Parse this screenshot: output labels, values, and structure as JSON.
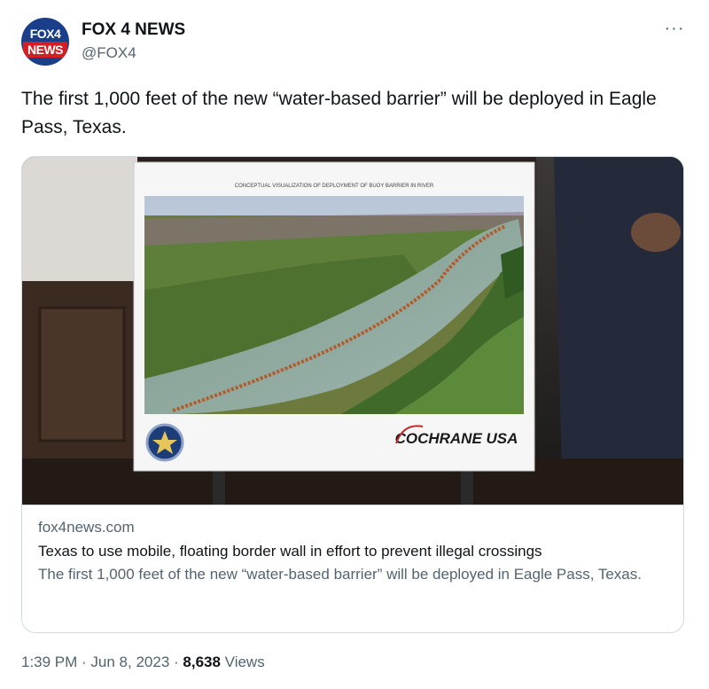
{
  "author": {
    "display_name": "FOX 4 NEWS",
    "handle": "@FOX4",
    "avatar_top": "FOX4",
    "avatar_bottom": "NEWS"
  },
  "more_label": "···",
  "tweet": {
    "text": "The first 1,000 feet of the new “water-based barrier” will be deployed in Eagle Pass, Texas."
  },
  "card": {
    "poster_caption": "CONCEPTUAL VISUALIZATION OF DEPLOYMENT OF BUOY BARRIER IN RIVER",
    "poster_brand": "COCHRANE USA",
    "domain": "fox4news.com",
    "title": "Texas to use mobile, floating border wall in effort to prevent illegal crossings",
    "description": "The first 1,000 feet of the new “water-based barrier” will be deployed in Eagle Pass, Texas."
  },
  "footer": {
    "time": "1:39 PM · Jun 8, 2023",
    "separator": " · ",
    "views_count": "8,638",
    "views_label": " Views"
  },
  "colors": {
    "text_primary": "#0f1419",
    "text_secondary": "#536471",
    "border": "#cfd9de",
    "brand_blue": "#1b3e8a",
    "brand_red": "#d21f26"
  }
}
